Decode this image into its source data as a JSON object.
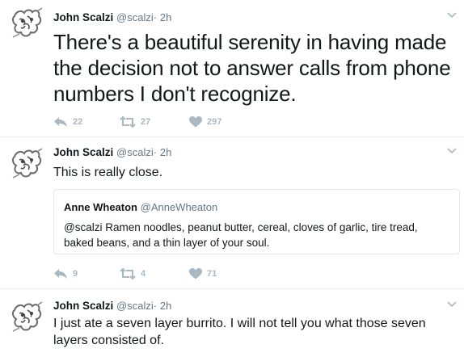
{
  "tweets": [
    {
      "author": "John Scalzi",
      "handle": "@scalzi",
      "dot": "·",
      "time": "2h",
      "text": "There's a beautiful serenity in having made the decision not to answer calls from phone numbers I don't recognize.",
      "replies": "22",
      "retweets": "27",
      "likes": "297"
    },
    {
      "author": "John Scalzi",
      "handle": "@scalzi",
      "dot": "·",
      "time": "2h",
      "text": "This is really close.",
      "quote": {
        "author": "Anne Wheaton",
        "handle": "@AnneWheaton",
        "text": "@scalzi Ramen noodles, peanut butter, cereal, cloves of garlic, tire tread, baked beans, and a thin layer of your soul."
      },
      "replies": "9",
      "retweets": "4",
      "likes": "71"
    },
    {
      "author": "John Scalzi",
      "handle": "@scalzi",
      "dot": "·",
      "time": "2h",
      "text": "I just ate a seven layer burrito. I will not tell you what those seven layers consisted of."
    }
  ],
  "icons": {
    "reply": "reply-icon",
    "retweet": "retweet-icon",
    "like": "heart-icon",
    "more": "chevron-down-icon"
  },
  "colors": {
    "text": "#14171a",
    "secondary": "#657786",
    "action": "#aab8c2",
    "divider": "#e6ecf0"
  }
}
